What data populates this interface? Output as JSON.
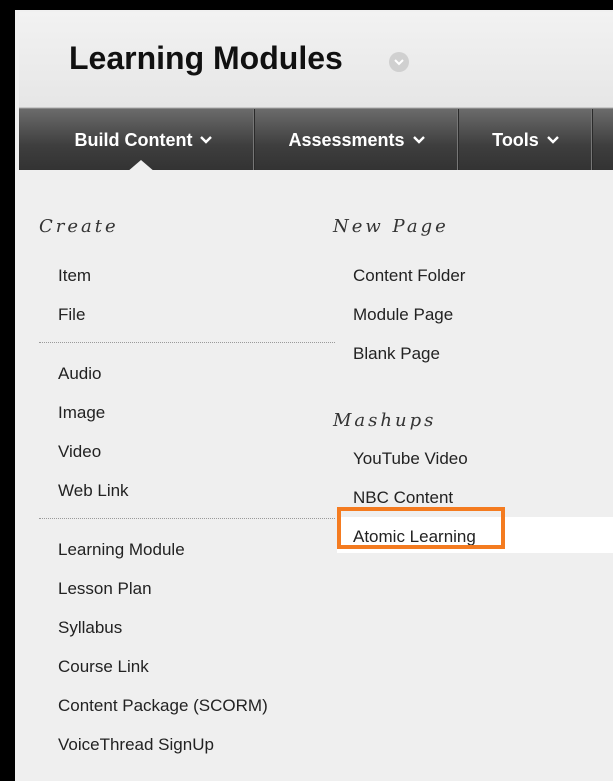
{
  "header": {
    "title": "Learning Modules"
  },
  "tabs": [
    {
      "label": "Build Content",
      "active": true
    },
    {
      "label": "Assessments"
    },
    {
      "label": "Tools"
    }
  ],
  "create": {
    "heading": "Create",
    "group1": [
      "Item",
      "File"
    ],
    "group2": [
      "Audio",
      "Image",
      "Video",
      "Web Link"
    ],
    "group3": [
      "Learning Module",
      "Lesson Plan",
      "Syllabus",
      "Course Link",
      "Content Package (SCORM)",
      "VoiceThread SignUp"
    ]
  },
  "new_page": {
    "heading": "New Page",
    "items": [
      "Content Folder",
      "Module Page",
      "Blank Page"
    ]
  },
  "mashups": {
    "heading": "Mashups",
    "items": [
      "YouTube Video",
      "NBC Content",
      "Atomic Learning"
    ],
    "highlighted": "Atomic Learning"
  },
  "colors": {
    "highlight": "#f47b20",
    "tabbar": "#3e3e3e"
  },
  "icons": {
    "title_menu": "chevron-down-circle-icon",
    "tab_menu": "chevron-down-icon"
  }
}
